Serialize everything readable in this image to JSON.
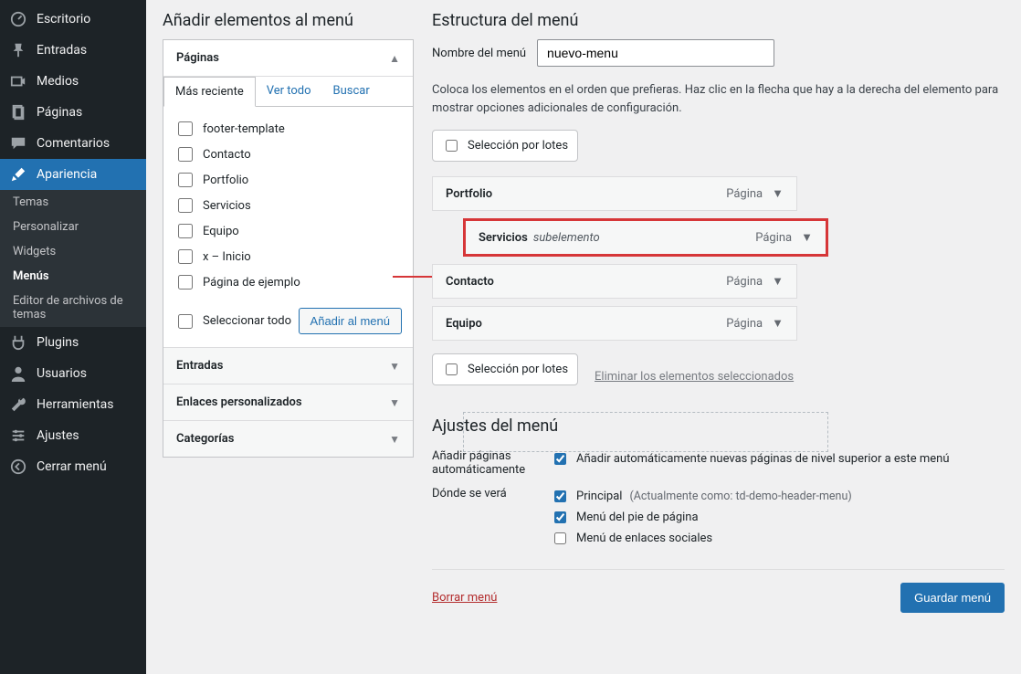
{
  "sidebar": {
    "items": [
      {
        "icon": "dashboard-icon",
        "label": "Escritorio"
      },
      {
        "icon": "pin-icon",
        "label": "Entradas"
      },
      {
        "icon": "media-icon",
        "label": "Medios"
      },
      {
        "icon": "page-icon",
        "label": "Páginas"
      },
      {
        "icon": "comment-icon",
        "label": "Comentarios"
      },
      {
        "icon": "brush-icon",
        "label": "Apariencia",
        "current": true,
        "subs": [
          {
            "label": "Temas"
          },
          {
            "label": "Personalizar"
          },
          {
            "label": "Widgets"
          },
          {
            "label": "Menús",
            "current": true
          },
          {
            "label": "Editor de archivos de temas"
          }
        ]
      },
      {
        "icon": "plugin-icon",
        "label": "Plugins"
      },
      {
        "icon": "user-icon",
        "label": "Usuarios"
      },
      {
        "icon": "tool-icon",
        "label": "Herramientas"
      },
      {
        "icon": "settings-icon",
        "label": "Ajustes"
      },
      {
        "icon": "collapse-icon",
        "label": "Cerrar menú"
      }
    ]
  },
  "left": {
    "heading": "Añadir elementos al menú",
    "acc": {
      "pages": {
        "title": "Páginas",
        "tabs": [
          "Más reciente",
          "Ver todo",
          "Buscar"
        ],
        "items": [
          "footer-template",
          "Contacto",
          "Portfolio",
          "Servicios",
          "Equipo",
          "x – Inicio",
          "Página de ejemplo"
        ],
        "select_all": "Seleccionar todo",
        "add_btn": "Añadir al menú"
      },
      "entries": "Entradas",
      "custom": "Enlaces personalizados",
      "cats": "Categorías"
    }
  },
  "right": {
    "heading": "Estructura del menú",
    "name_label": "Nombre del menú",
    "name_value": "nuevo-menu",
    "help": "Coloca los elementos en el orden que prefieras. Haz clic en la flecha que hay a la derecha del elemento para mostrar opciones adicionales de configuración.",
    "batch": "Selección por lotes",
    "menu_items": [
      {
        "title": "Portfolio",
        "note": "",
        "type": "Página",
        "hl": false,
        "sub": false
      },
      {
        "title": "Servicios",
        "note": "subelemento",
        "type": "Página",
        "hl": true,
        "sub": true
      },
      {
        "title": "Contacto",
        "note": "",
        "type": "Página",
        "hl": false,
        "sub": false
      },
      {
        "title": "Equipo",
        "note": "",
        "type": "Página",
        "hl": false,
        "sub": false
      }
    ],
    "batch2": "Selección por lotes",
    "del_sel": "Eliminar los elementos seleccionados",
    "settings_heading": "Ajustes del menú",
    "auto_add_label": "Añadir páginas automáticamente",
    "auto_add_opt": "Añadir automáticamente nuevas páginas de nivel superior a este menú",
    "where_label": "Dónde se verá",
    "loc_main": "Principal",
    "loc_main_note": "(Actualmente como: td-demo-header-menu)",
    "loc_footer": "Menú del pie de página",
    "loc_social": "Menú de enlaces sociales",
    "delete_menu": "Borrar menú",
    "save": "Guardar menú"
  }
}
